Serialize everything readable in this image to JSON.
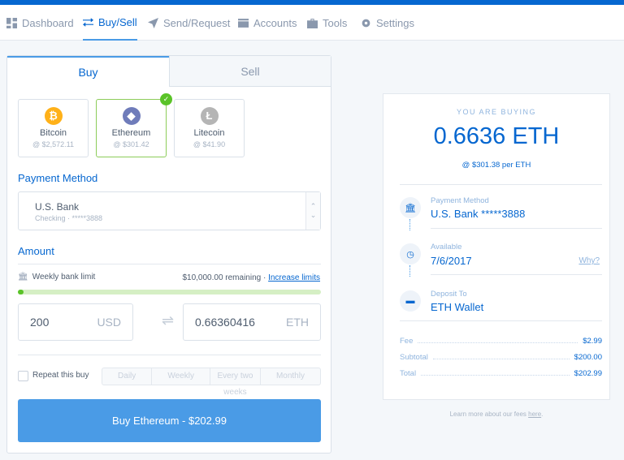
{
  "nav": {
    "items": [
      {
        "label": "Dashboard",
        "icon": "dashboard-icon"
      },
      {
        "label": "Buy/Sell",
        "icon": "swap-icon",
        "active": true
      },
      {
        "label": "Send/Request",
        "icon": "send-icon"
      },
      {
        "label": "Accounts",
        "icon": "wallet-icon"
      },
      {
        "label": "Tools",
        "icon": "toolbox-icon"
      },
      {
        "label": "Settings",
        "icon": "gear-icon"
      }
    ]
  },
  "tabs": {
    "buy": "Buy",
    "sell": "Sell"
  },
  "coins": [
    {
      "name": "Bitcoin",
      "price": "@ $2,572.11",
      "color": "#ffb119",
      "glyph": "₿"
    },
    {
      "name": "Ethereum",
      "price": "@ $301.42",
      "color": "#6f7cba",
      "glyph": "◆",
      "selected": true
    },
    {
      "name": "Litecoin",
      "price": "@ $41.90",
      "color": "#b5b5b5",
      "glyph": "Ł"
    }
  ],
  "payment": {
    "title": "Payment Method",
    "bank": "U.S. Bank",
    "detail": "Checking · *****3888"
  },
  "amount": {
    "title": "Amount",
    "limit_label": "Weekly bank limit",
    "remaining": "$10,000.00 remaining ·",
    "increase": "Increase limits",
    "limit_used_fraction": 0.02,
    "usd_value": "200",
    "usd_unit": "USD",
    "eth_value": "0.66360416",
    "eth_unit": "ETH"
  },
  "repeat": {
    "label": "Repeat this buy",
    "options": [
      "Daily",
      "Weekly",
      "Every two weeks",
      "Monthly"
    ]
  },
  "buy_button": "Buy Ethereum - $202.99",
  "summary": {
    "heading": "YOU ARE BUYING",
    "amount": "0.6636 ETH",
    "rate": "@ $301.38 per ETH",
    "payment_label": "Payment Method",
    "payment_value": "U.S. Bank *****3888",
    "available_label": "Available",
    "available_value": "7/6/2017",
    "why": "Why?",
    "deposit_label": "Deposit To",
    "deposit_value": "ETH Wallet",
    "fee_label": "Fee",
    "fee": "$2.99",
    "subtotal_label": "Subtotal",
    "subtotal": "$200.00",
    "total_label": "Total",
    "total": "$202.99"
  },
  "footer": {
    "text": "Learn more about our fees ",
    "link": "here",
    "end": "."
  },
  "colors": {
    "brand": "#0667d0",
    "button": "#4a9be6",
    "success": "#5ac328"
  }
}
